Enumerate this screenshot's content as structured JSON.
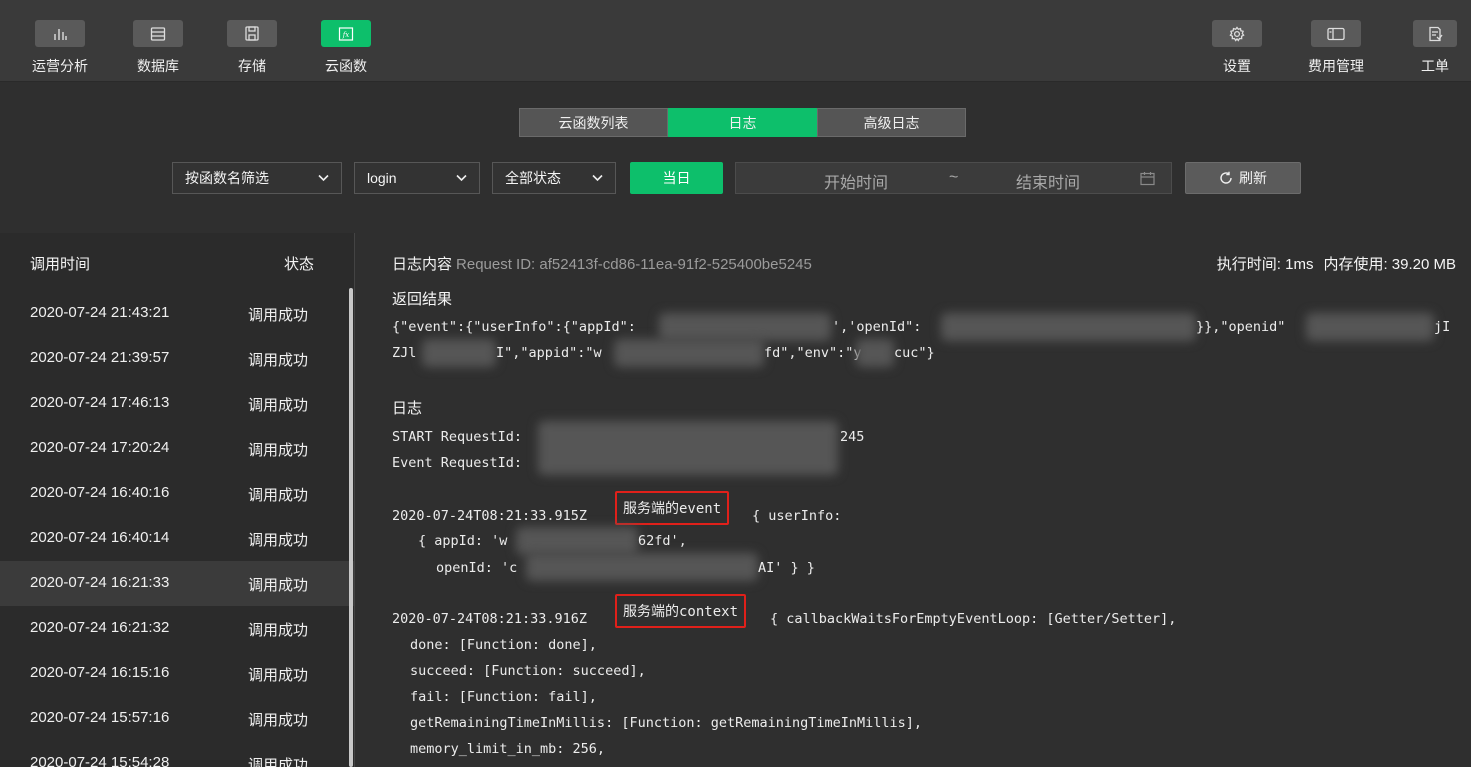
{
  "toolbar": {
    "left": [
      {
        "label": "运营分析",
        "icon": "bar-chart-icon"
      },
      {
        "label": "数据库",
        "icon": "database-icon"
      },
      {
        "label": "存储",
        "icon": "storage-icon"
      },
      {
        "label": "云函数",
        "icon": "cloud-function-icon"
      }
    ],
    "right": [
      {
        "label": "设置",
        "icon": "gear-icon"
      },
      {
        "label": "费用管理",
        "icon": "billing-icon"
      },
      {
        "label": "工单",
        "icon": "ticket-icon"
      }
    ],
    "active": "云函数"
  },
  "tabs": [
    {
      "label": "云函数列表"
    },
    {
      "label": "日志"
    },
    {
      "label": "高级日志"
    }
  ],
  "filters": {
    "function_filter": "按函数名筛选",
    "function_name": "login",
    "status": "全部状态",
    "today_label": "当日",
    "start_placeholder": "开始时间",
    "range_sep": "~",
    "end_placeholder": "结束时间",
    "refresh_label": "刷新"
  },
  "log_list": {
    "headers": {
      "time": "调用时间",
      "status": "状态"
    },
    "rows": [
      {
        "time": "2020-07-24 21:43:21",
        "status": "调用成功"
      },
      {
        "time": "2020-07-24 21:39:57",
        "status": "调用成功"
      },
      {
        "time": "2020-07-24 17:46:13",
        "status": "调用成功"
      },
      {
        "time": "2020-07-24 17:20:24",
        "status": "调用成功"
      },
      {
        "time": "2020-07-24 16:40:16",
        "status": "调用成功"
      },
      {
        "time": "2020-07-24 16:40:14",
        "status": "调用成功"
      },
      {
        "time": "2020-07-24 16:21:33",
        "status": "调用成功"
      },
      {
        "time": "2020-07-24 16:21:32",
        "status": "调用成功"
      },
      {
        "time": "2020-07-24 16:15:16",
        "status": "调用成功"
      },
      {
        "time": "2020-07-24 15:57:16",
        "status": "调用成功"
      },
      {
        "time": "2020-07-24 15:54:28",
        "status": "调用成功"
      }
    ],
    "selected_index": 6
  },
  "detail": {
    "content_label": "日志内容",
    "request_id": "Request ID: af52413f-cd86-11ea-91f2-525400be5245",
    "exec_time": "执行时间: 1ms",
    "memory": "内存使用: 39.20 MB",
    "result_title": "返回结果",
    "result_line1_a": "{\"event\":{\"userInfo\":{\"appId\":",
    "result_line1_b": "','openId\":",
    "result_line1_c": "}},\"openid\"",
    "result_line1_d": "jI",
    "result_line2_a": "ZJl",
    "result_line2_b": "I\",\"appid\":\"w",
    "result_line2_c": "fd\",\"env\":\"y",
    "result_line2_d": "cuc\"}",
    "log_title": "日志",
    "start_req": "START RequestId:",
    "start_req_tail": "245",
    "event_req": "Event RequestId:",
    "event_ts": "2020-07-24T08:21:33.915Z",
    "event_hl": "服务端的event",
    "event_rest": "{ userInfo:",
    "event_appid_a": "{ appId: 'w",
    "event_appid_b": "62fd',",
    "event_openid_a": "openId: 'c",
    "event_openid_b": "AI' } }",
    "ctx_ts": "2020-07-24T08:21:33.916Z",
    "ctx_hl": "服务端的context",
    "ctx_rest": "{ callbackWaitsForEmptyEventLoop: [Getter/Setter],",
    "ctx_lines": [
      "done: [Function: done],",
      "succeed: [Function: succeed],",
      "fail: [Function: fail],",
      "getRemainingTimeInMillis: [Function: getRemainingTimeInMillis],",
      "memory_limit_in_mb: 256,"
    ]
  },
  "colors": {
    "accent": "#0dbf6b",
    "highlight": "#e0201a"
  }
}
